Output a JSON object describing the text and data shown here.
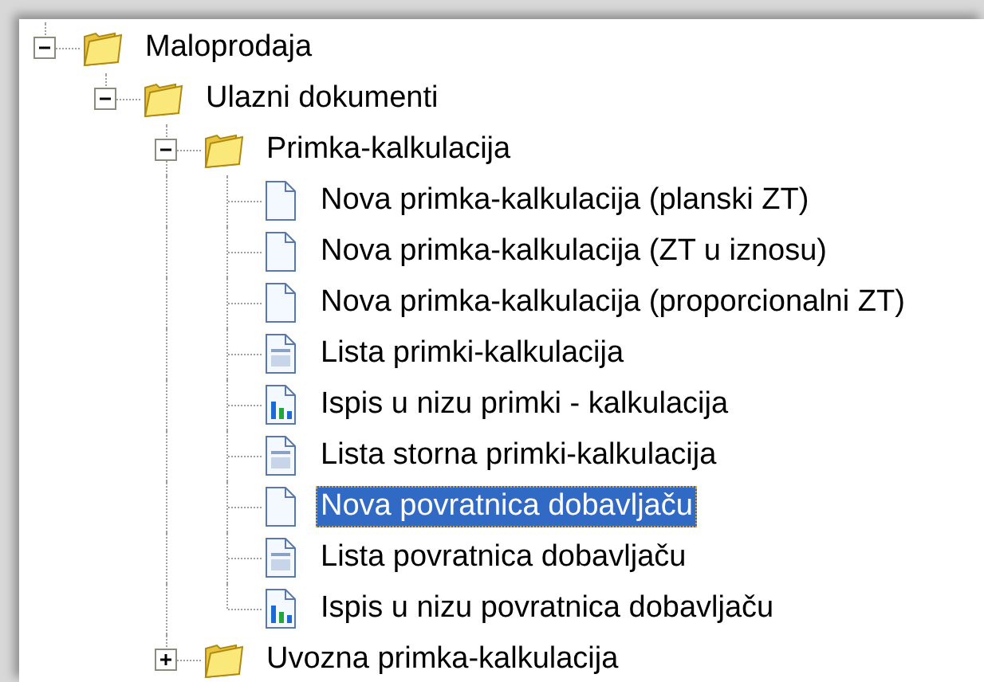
{
  "tree": [
    {
      "label": "Maloprodaja",
      "kind": "folder",
      "expanded": true,
      "children": [
        {
          "label": "Ulazni dokumenti",
          "kind": "folder",
          "expanded": true,
          "children": [
            {
              "label": "Primka-kalkulacija",
              "kind": "folder",
              "expanded": true,
              "children": [
                {
                  "label": "Nova primka-kalkulacija (planski ZT)",
                  "kind": "new",
                  "selected": false
                },
                {
                  "label": "Nova primka-kalkulacija (ZT u iznosu)",
                  "kind": "new",
                  "selected": false
                },
                {
                  "label": "Nova primka-kalkulacija (proporcionalni ZT)",
                  "kind": "new",
                  "selected": false
                },
                {
                  "label": "Lista primki-kalkulacija",
                  "kind": "list",
                  "selected": false
                },
                {
                  "label": "Ispis u nizu primki - kalkulacija",
                  "kind": "report",
                  "selected": false
                },
                {
                  "label": "Lista storna primki-kalkulacija",
                  "kind": "list",
                  "selected": false
                },
                {
                  "label": "Nova povratnica dobavljaču",
                  "kind": "new",
                  "selected": true
                },
                {
                  "label": "Lista povratnica dobavljaču",
                  "kind": "list",
                  "selected": false
                },
                {
                  "label": "Ispis u nizu povratnica dobavljaču",
                  "kind": "report",
                  "selected": false
                }
              ]
            },
            {
              "label": "Uvozna primka-kalkulacija",
              "kind": "folder",
              "expanded": false
            }
          ]
        }
      ]
    }
  ]
}
